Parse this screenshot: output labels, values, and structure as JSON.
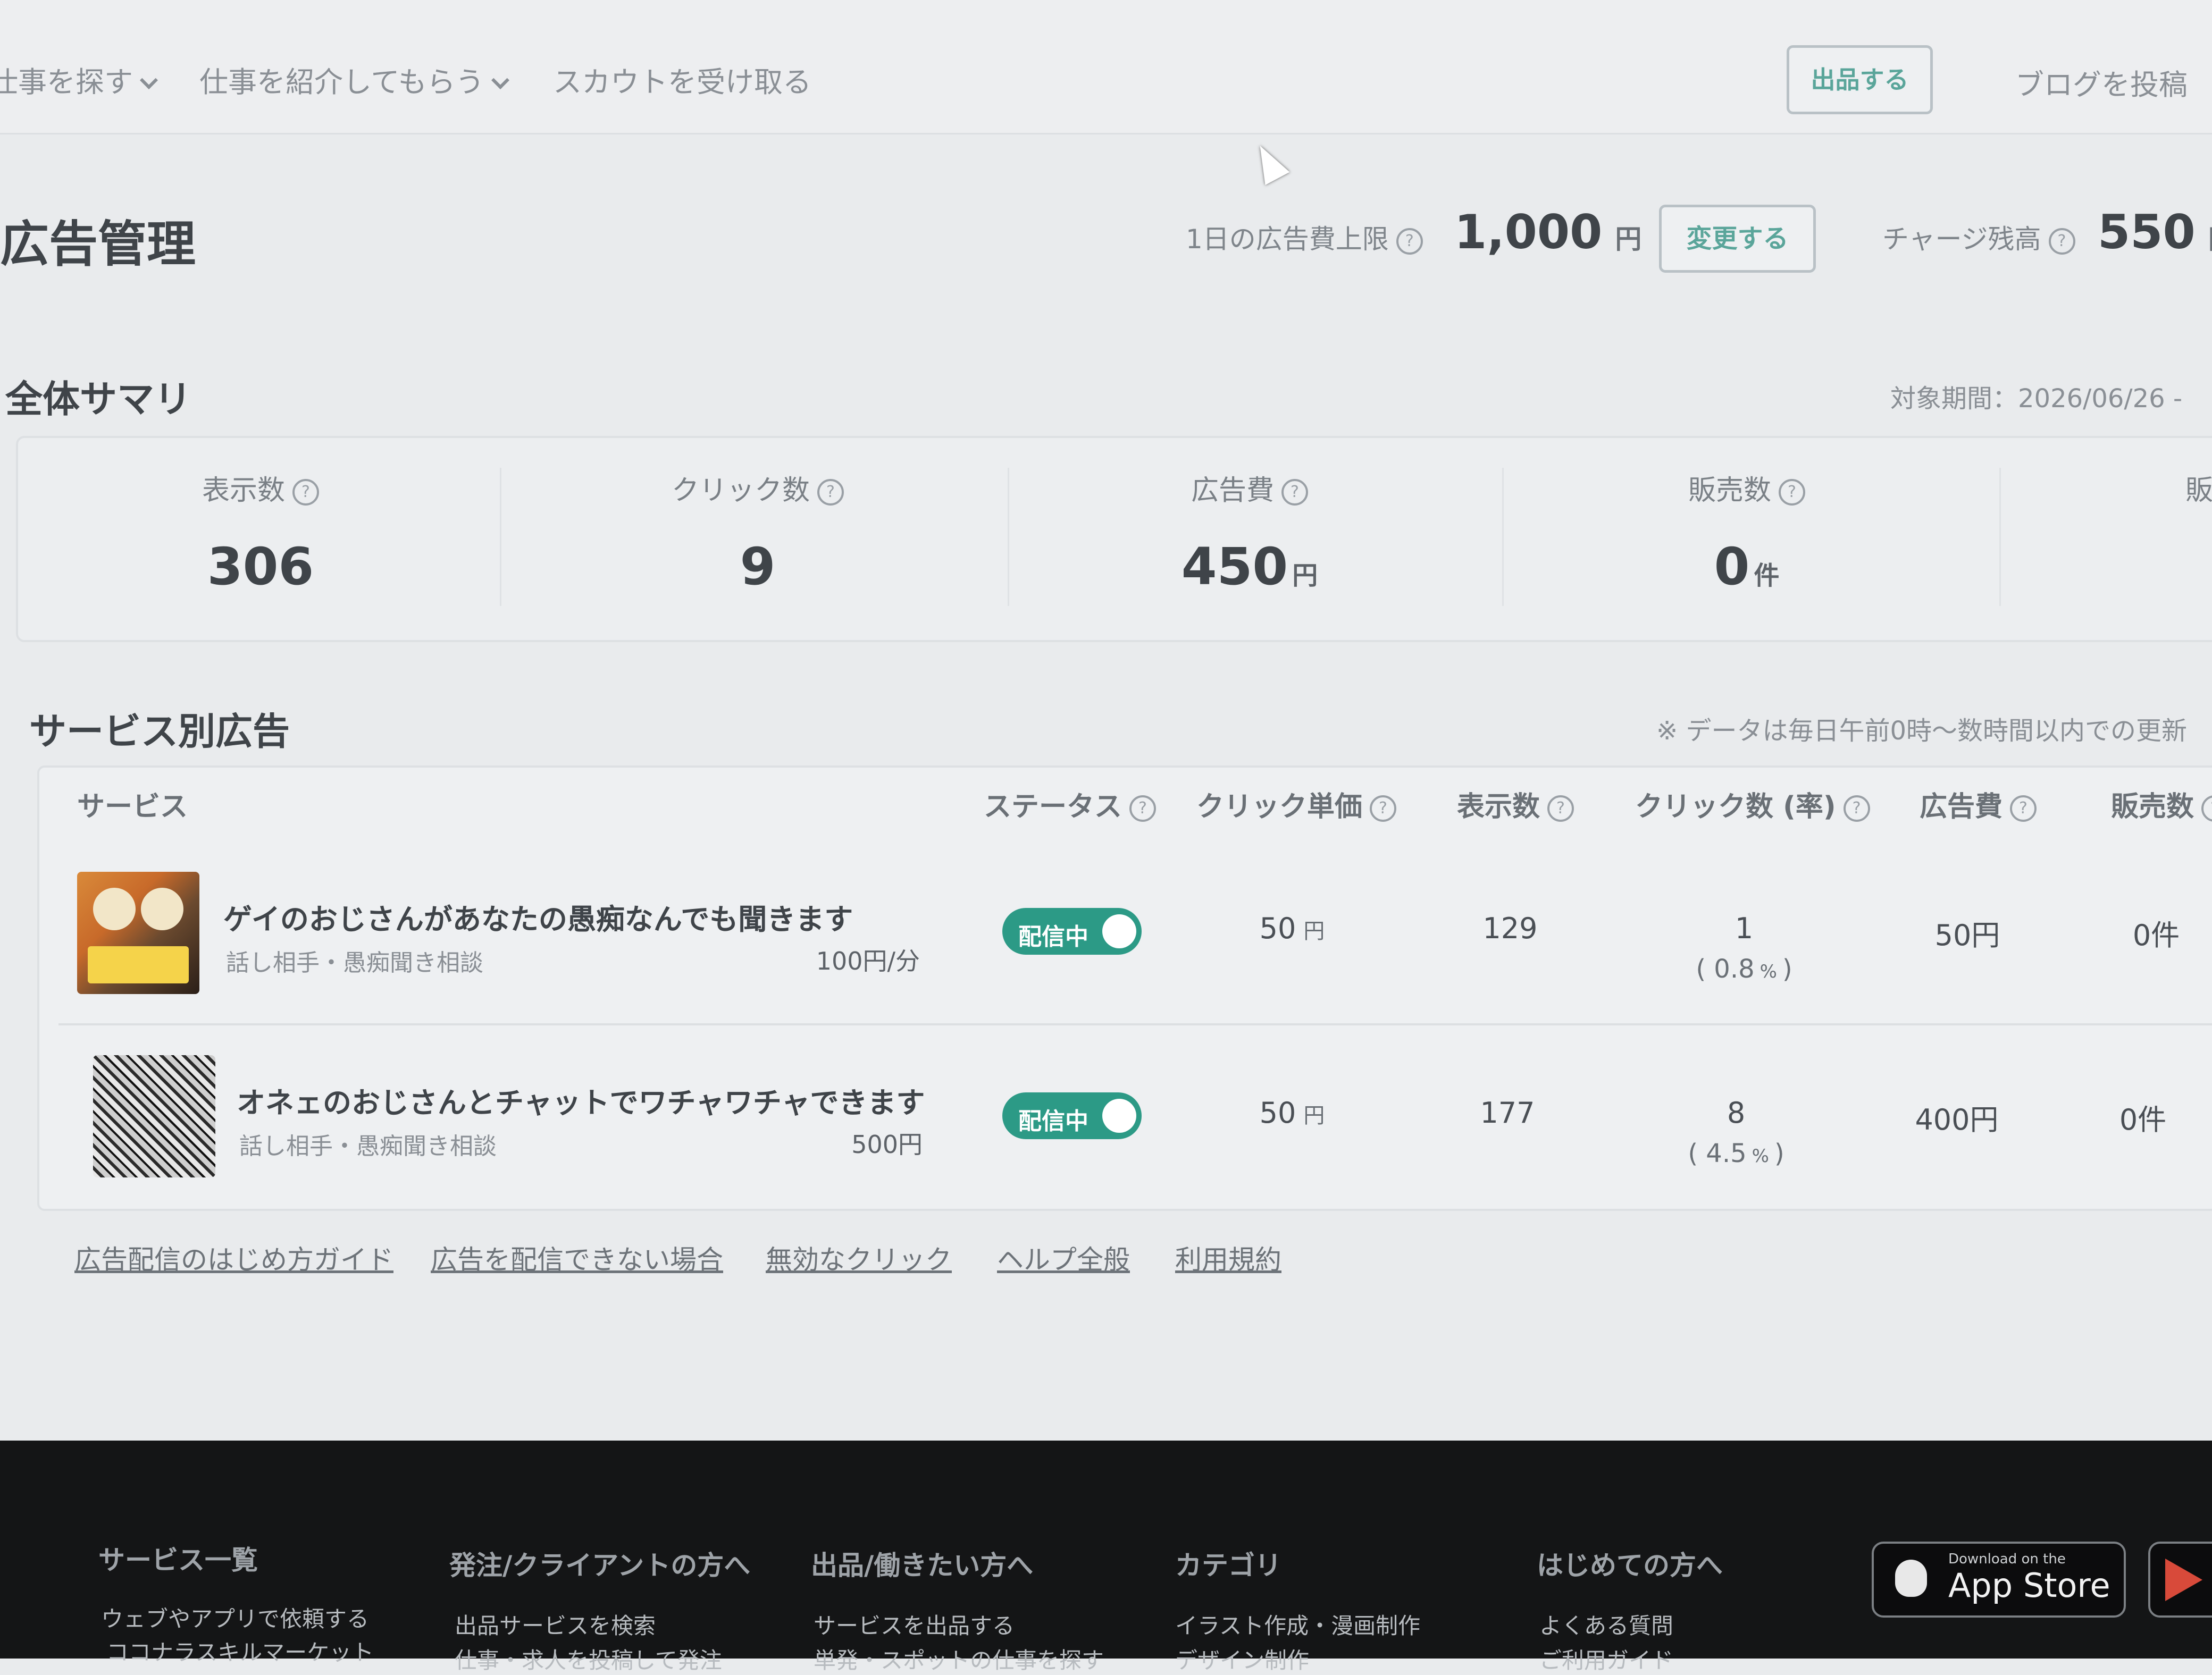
{
  "nav": {
    "items": [
      "仕事を探す",
      "仕事を紹介してもらう",
      "スカウトを受け取る"
    ],
    "post_service": "出品する",
    "post_blog": "ブログを投稿"
  },
  "header": {
    "title": "広告管理",
    "daily_limit_label": "1日の広告費上限",
    "daily_limit_value": "1,000",
    "daily_limit_unit": "円",
    "change_button": "変更する",
    "balance_label": "チャージ残高",
    "balance_value": "550",
    "balance_unit": "円"
  },
  "summary": {
    "title": "全体サマリ",
    "period_label": "対象期間：2026/06/26 -",
    "stats": [
      {
        "label": "表示数",
        "value": "306",
        "unit": ""
      },
      {
        "label": "クリック数",
        "value": "9",
        "unit": ""
      },
      {
        "label": "広告費",
        "value": "450",
        "unit": "円"
      },
      {
        "label": "販売数",
        "value": "0",
        "unit": "件"
      },
      {
        "label": "販"
      }
    ]
  },
  "services": {
    "title": "サービス別広告",
    "note": "※ データは毎日午前0時〜数時間以内での更新",
    "columns": [
      "サービス",
      "ステータス",
      "クリック単価",
      "表示数",
      "クリック数 (率)",
      "広告費",
      "販売数"
    ],
    "rows": [
      {
        "title": "ゲイのおじさんがあなたの愚痴なんでも聞きます",
        "category": "話し相手・愚痴聞き相談",
        "price": "100円/分",
        "status": "配信中",
        "cpc": "50",
        "cpc_unit": "円",
        "impressions": "129",
        "clicks": "1",
        "rate": "0.8",
        "spend": "50円",
        "sales": "0件"
      },
      {
        "title": "オネェのおじさんとチャットでワチャワチャできます",
        "category": "話し相手・愚痴聞き相談",
        "price": "500円",
        "status": "配信中",
        "cpc": "50",
        "cpc_unit": "円",
        "impressions": "177",
        "clicks": "8",
        "rate": "4.5",
        "spend": "400円",
        "sales": "0件"
      }
    ]
  },
  "links": [
    "広告配信のはじめ方ガイド",
    "広告を配信できない場合",
    "無効なクリック",
    "ヘルプ全般",
    "利用規約"
  ],
  "footer": {
    "columns": [
      {
        "title": "サービス一覧",
        "links": [
          "ウェブやアプリで依頼する",
          "ココナラスキルマーケット"
        ]
      },
      {
        "title": "発注/クライアントの方へ",
        "links": [
          "出品サービスを検索",
          "仕事・求人を投稿して発注"
        ]
      },
      {
        "title": "出品/働きたい方へ",
        "links": [
          "サービスを出品する",
          "単発・スポットの仕事を探す"
        ]
      },
      {
        "title": "カテゴリ",
        "links": [
          "イラスト作成・漫画制作",
          "デザイン制作"
        ]
      },
      {
        "title": "はじめての方へ",
        "links": [
          "よくある質問",
          "ご利用ガイド"
        ]
      }
    ],
    "app_store_small": "Download on the",
    "app_store": "App Store"
  },
  "colors": {
    "accent": "#2c9a86",
    "footer_bg": "#141516",
    "page_bg": "#e9ebed"
  }
}
